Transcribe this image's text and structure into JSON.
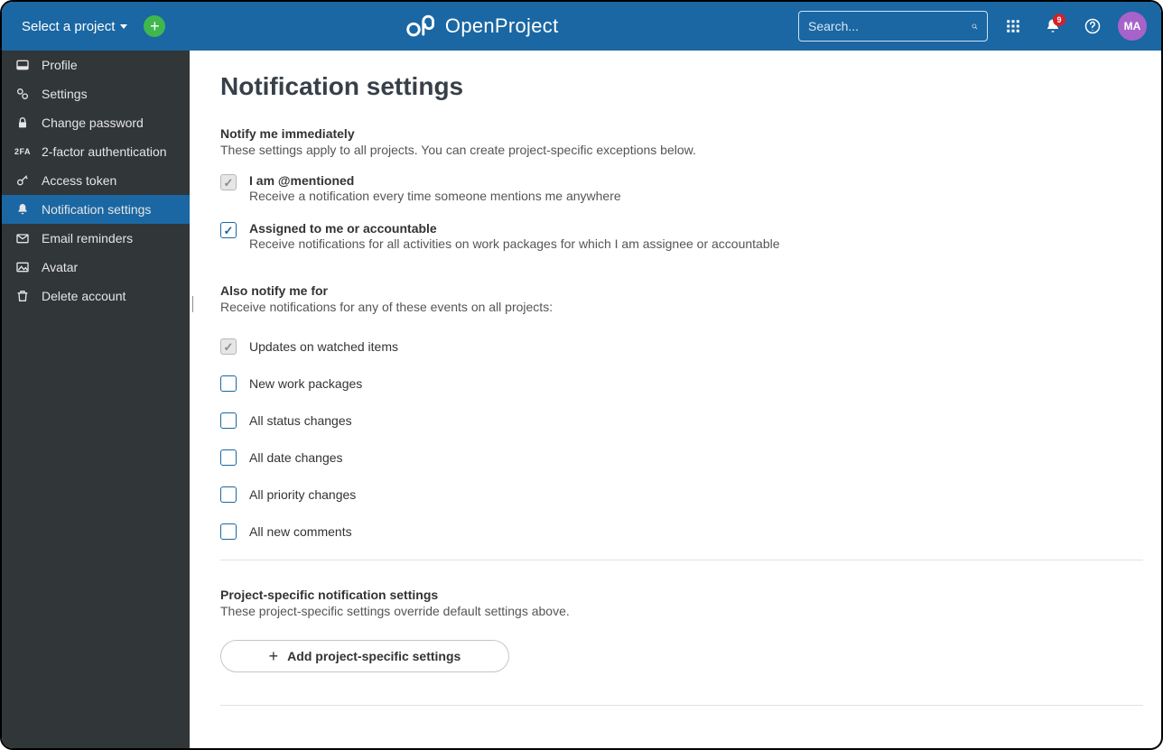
{
  "header": {
    "project_selector": "Select a project",
    "search_placeholder": "Search...",
    "logo_text": "OpenProject",
    "notif_count": "9",
    "avatar_initials": "MA"
  },
  "sidebar": {
    "items": [
      {
        "label": "Profile"
      },
      {
        "label": "Settings"
      },
      {
        "label": "Change password"
      },
      {
        "label": "2-factor authentication"
      },
      {
        "label": "Access token"
      },
      {
        "label": "Notification settings"
      },
      {
        "label": "Email reminders"
      },
      {
        "label": "Avatar"
      },
      {
        "label": "Delete account"
      }
    ]
  },
  "page": {
    "title": "Notification settings",
    "notify_title": "Notify me immediately",
    "notify_desc": "These settings apply to all projects. You can create project-specific exceptions below.",
    "mentioned_label": "I am @mentioned",
    "mentioned_sub": "Receive a notification every time someone mentions me anywhere",
    "assigned_label": "Assigned to me or accountable",
    "assigned_sub": "Receive notifications for all activities on work packages for which I am assignee or accountable",
    "also_title": "Also notify me for",
    "also_desc": "Receive notifications for any of these events on all projects:",
    "also_items": [
      "Updates on watched items",
      "New work packages",
      "All status changes",
      "All date changes",
      "All priority changes",
      "All new comments"
    ],
    "proj_title": "Project-specific notification settings",
    "proj_desc": "These project-specific settings override default settings above.",
    "add_btn": "Add project-specific settings"
  }
}
